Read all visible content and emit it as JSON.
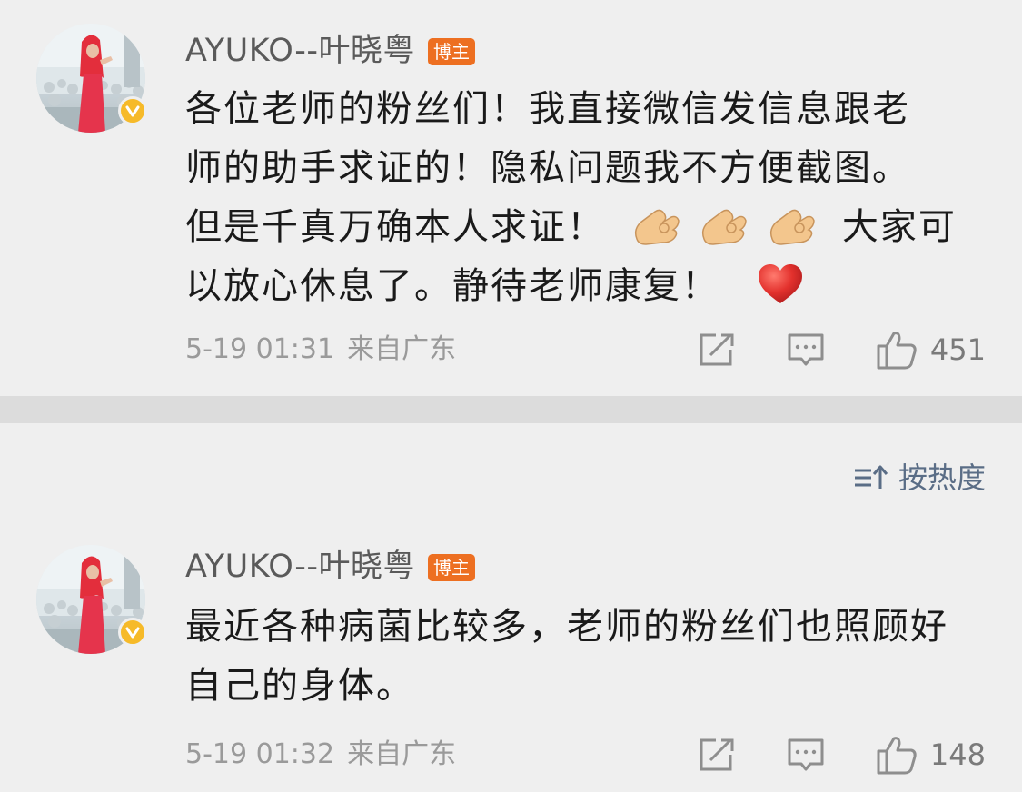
{
  "comments": [
    {
      "username": "AYUKO--叶晓粤",
      "badge": "博主",
      "lines": [
        "各位老师的粉丝们！我直接微信发信息跟老",
        "师的助手求证的！隐私问题我不方便截图。",
        "但是千真万确本人求证！",
        "大家可",
        "以放心休息了。静待老师康复！"
      ],
      "emojis": [
        "ok-hand-emoji",
        "ok-hand-emoji",
        "ok-hand-emoji",
        "red-heart-emoji"
      ],
      "date": "5-19 01:31",
      "source": "来自广东",
      "likes": "451"
    },
    {
      "username": "AYUKO--叶晓粤",
      "badge": "博主",
      "lines": [
        "最近各种病菌比较多，老师的粉丝们也照顾好",
        "自己的身体。"
      ],
      "date": "5-19 01:32",
      "source": "来自广东",
      "likes": "148"
    }
  ],
  "sort": {
    "label": "按热度",
    "icon": "sort-icon"
  },
  "icons": {
    "repost": "share-icon",
    "comment": "comment-icon",
    "like": "thumbs-up-icon",
    "verified": "verified-icon"
  },
  "colors": {
    "background": "#efefef",
    "separator": "#dcdcdc",
    "badge": "#ed6f21",
    "verified": "#f6ba29",
    "sort_text": "#5a6d86",
    "heart": "#e3312d"
  }
}
